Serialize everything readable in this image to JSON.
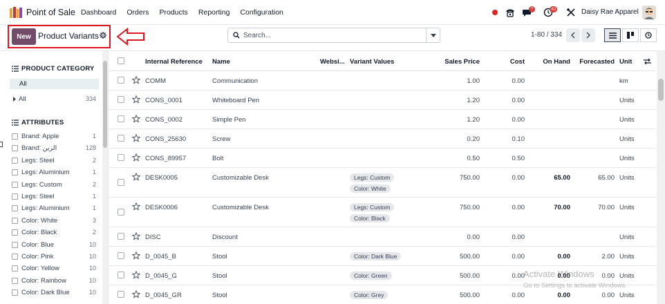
{
  "app": {
    "name": "Point of Sale",
    "menu": [
      "Dashboard",
      "Orders",
      "Products",
      "Reporting",
      "Configuration"
    ],
    "company": "Daisy Rae Apparel",
    "messages_badge": "7",
    "activity_badge": "40"
  },
  "control_panel": {
    "new_label": "New",
    "title": "Product Variants",
    "search_placeholder": "Search...",
    "pager": "1-80 / 334"
  },
  "sidebar": {
    "category_title": "PRODUCT CATEGORY",
    "category_selected": "All",
    "category_all": {
      "label": "All",
      "count": "334"
    },
    "attributes_title": "ATTRIBUTES",
    "attributes": [
      {
        "label": "Brand: Apple",
        "count": "1"
      },
      {
        "label": "Brand: الزين",
        "count": "128"
      },
      {
        "label": "Legs: Steel",
        "count": "2"
      },
      {
        "label": "Legs: Aluminium",
        "count": "1"
      },
      {
        "label": "Legs: Custom",
        "count": "2"
      },
      {
        "label": "Legs: Steel",
        "count": "1"
      },
      {
        "label": "Legs: Aluminium",
        "count": "1"
      },
      {
        "label": "Color: White",
        "count": "3"
      },
      {
        "label": "Color: Black",
        "count": "2"
      },
      {
        "label": "Color: Blue",
        "count": "10"
      },
      {
        "label": "Color: Pink",
        "count": "10"
      },
      {
        "label": "Color: Yellow",
        "count": "10"
      },
      {
        "label": "Color: Rainbow",
        "count": "10"
      },
      {
        "label": "Color: Dark Blue",
        "count": "10"
      }
    ]
  },
  "table": {
    "headers": {
      "ref": "Internal Reference",
      "name": "Name",
      "website": "Websi...",
      "variants": "Variant Values",
      "price": "Sales Price",
      "cost": "Cost",
      "onhand": "On Hand",
      "forecast": "Forecasted",
      "unit": "Unit"
    },
    "rows": [
      {
        "ref": "COMM",
        "name": "Communication",
        "tags": [],
        "price": "1.00",
        "cost": "0.00",
        "onhand": "",
        "forecast": "",
        "unit": "km"
      },
      {
        "ref": "CONS_0001",
        "name": "Whiteboard Pen",
        "tags": [],
        "price": "1.20",
        "cost": "0.00",
        "onhand": "",
        "forecast": "",
        "unit": "Units"
      },
      {
        "ref": "CONS_0002",
        "name": "Simple Pen",
        "tags": [],
        "price": "1.20",
        "cost": "0.00",
        "onhand": "",
        "forecast": "",
        "unit": "Units"
      },
      {
        "ref": "CONS_25630",
        "name": "Screw",
        "tags": [],
        "price": "0.20",
        "cost": "0.10",
        "onhand": "",
        "forecast": "",
        "unit": "Units"
      },
      {
        "ref": "CONS_89957",
        "name": "Bolt",
        "tags": [],
        "price": "0.50",
        "cost": "0.50",
        "onhand": "",
        "forecast": "",
        "unit": "Units"
      },
      {
        "ref": "DESK0005",
        "name": "Customizable Desk",
        "tags": [
          "Legs: Custom",
          "Color: White"
        ],
        "price": "750.00",
        "cost": "0.00",
        "onhand": "65.00",
        "forecast": "65.00",
        "unit": "Units"
      },
      {
        "ref": "DESK0006",
        "name": "Customizable Desk",
        "tags": [
          "Legs: Custom",
          "Color: Black"
        ],
        "price": "750.00",
        "cost": "0.00",
        "onhand": "70.00",
        "forecast": "70.00",
        "unit": "Units"
      },
      {
        "ref": "DISC",
        "name": "Discount",
        "tags": [],
        "price": "0.00",
        "cost": "0.00",
        "onhand": "",
        "forecast": "",
        "unit": "Units"
      },
      {
        "ref": "D_0045_B",
        "name": "Stool",
        "tags": [
          "Color: Dark Blue"
        ],
        "price": "500.00",
        "cost": "0.00",
        "onhand": "0.00",
        "forecast": "2.00",
        "unit": "Units"
      },
      {
        "ref": "D_0045_G",
        "name": "Stool",
        "tags": [
          "Color: Green"
        ],
        "price": "500.00",
        "cost": "0.00",
        "onhand": "0.00",
        "forecast": "0.00",
        "unit": "Units"
      },
      {
        "ref": "D_0045_GR",
        "name": "Stool",
        "tags": [
          "Color: Grey"
        ],
        "price": "500.00",
        "cost": "0.00",
        "onhand": "0.00",
        "forecast": "0.00",
        "unit": "Units"
      }
    ]
  },
  "watermark": {
    "line1": "Activate Windows",
    "line2": "Go to Settings to activate Windows."
  }
}
